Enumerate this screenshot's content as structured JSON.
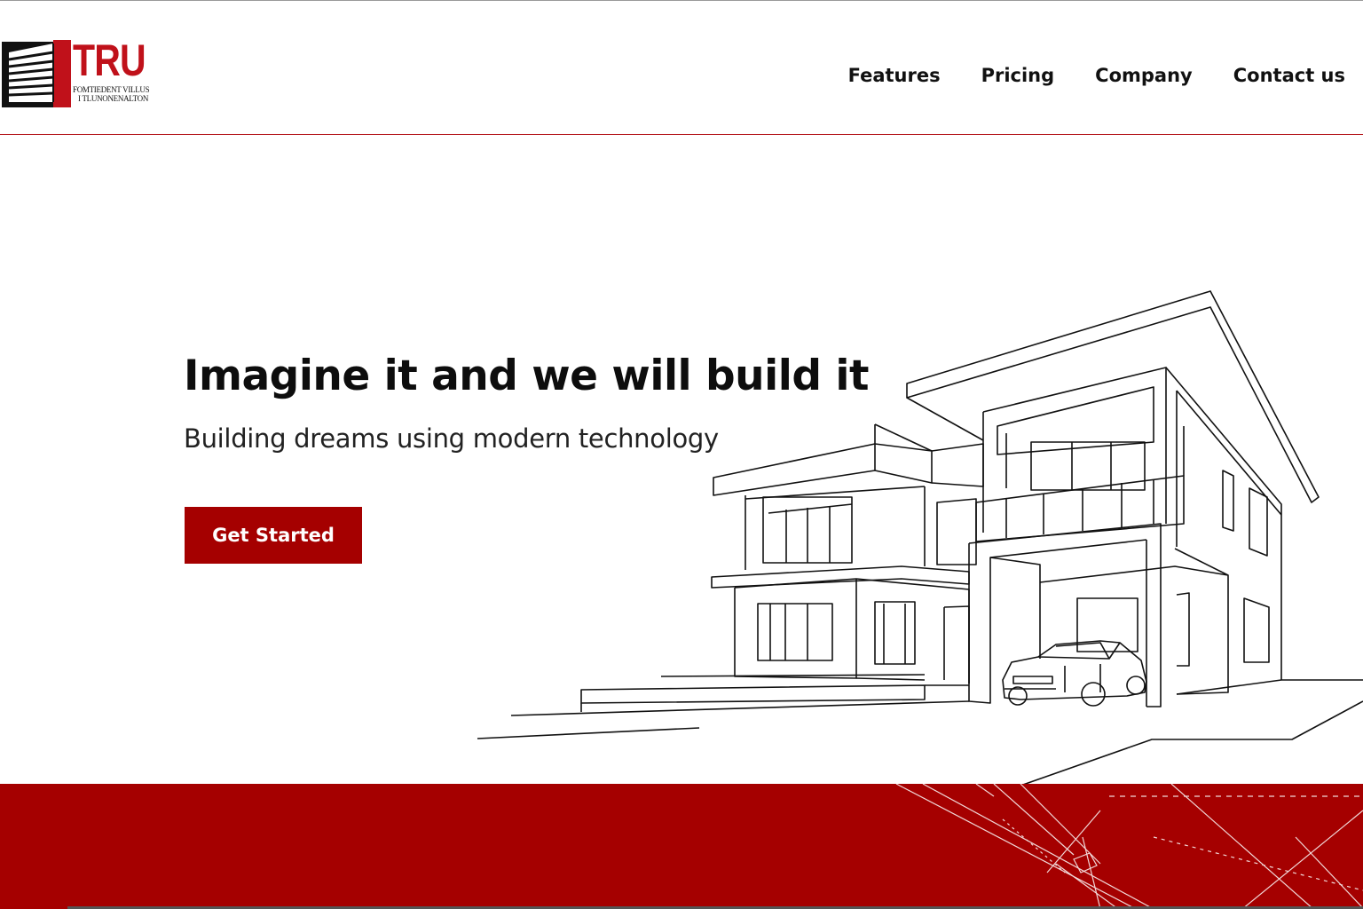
{
  "brand": {
    "name": "TRU",
    "tagline_line1": "FOMTIEDENT VILLUS",
    "tagline_line2": "I TLUNONENALTON",
    "accent_color": "#a50000"
  },
  "nav": {
    "items": [
      {
        "label": "Features"
      },
      {
        "label": "Pricing"
      },
      {
        "label": "Company"
      },
      {
        "label": "Contact us"
      }
    ]
  },
  "hero": {
    "title": "Imagine it and we will build it",
    "subtitle": "Building dreams using modern technology",
    "cta_label": "Get Started",
    "illustration": "house-line-drawing"
  },
  "footer_band": {
    "color": "#a50000",
    "decoration": "blueprint-lines"
  }
}
